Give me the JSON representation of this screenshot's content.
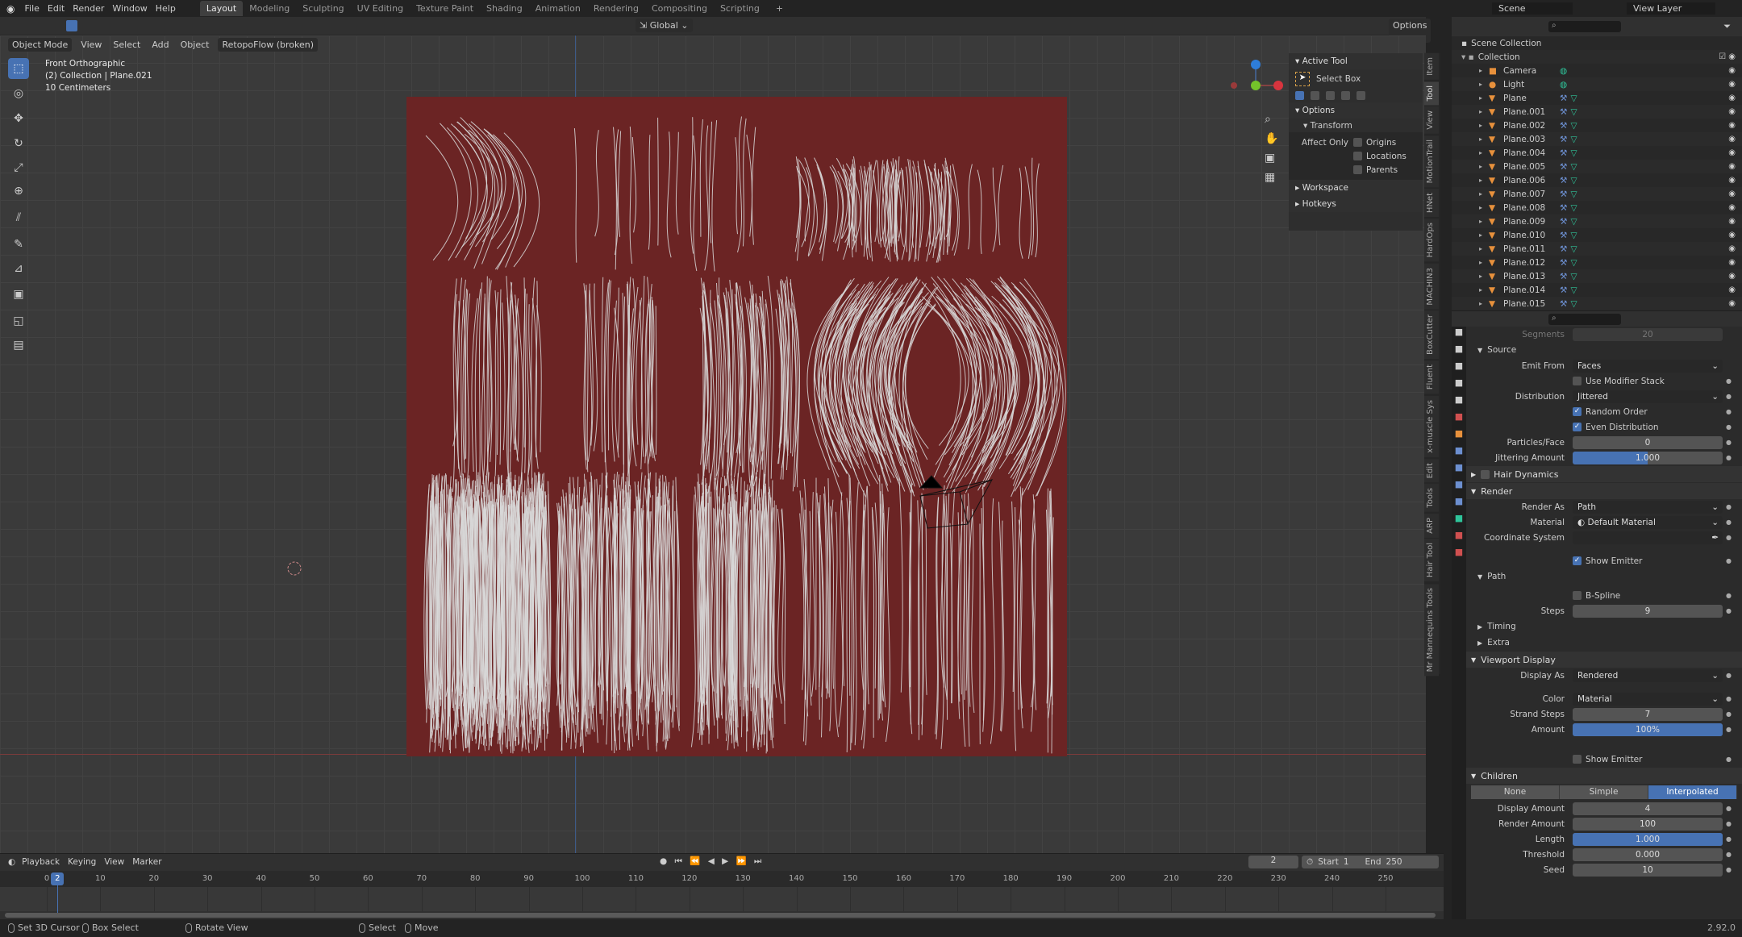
{
  "topbar": {
    "menus": [
      "File",
      "Edit",
      "Render",
      "Window",
      "Help"
    ],
    "workspaces": [
      "Layout",
      "Modeling",
      "Sculpting",
      "UV Editing",
      "Texture Paint",
      "Shading",
      "Animation",
      "Rendering",
      "Compositing",
      "Scripting"
    ],
    "active_workspace": "Layout",
    "scene": "Scene",
    "view_layer": "View Layer"
  },
  "tool_header": {
    "orientation": "Global",
    "options": "Options"
  },
  "viewport_header": {
    "mode": "Object Mode",
    "menus": [
      "View",
      "Select",
      "Add",
      "Object"
    ],
    "addon": "RetopoFlow (broken)"
  },
  "viewport_info": {
    "view": "Front Orthographic",
    "collection": "(2) Collection | Plane.021",
    "scale": "10 Centimeters"
  },
  "viewport": {
    "plane_color": "#6b2424",
    "hair_color": "#d8d8d8"
  },
  "toolbar": [
    "select-box",
    "cursor",
    "move",
    "rotate",
    "scale",
    "transform",
    "annotate-line",
    "annotate",
    "measure",
    "add-cube",
    "shear",
    "scale-cage"
  ],
  "npanel": {
    "active_tool_header": "Active Tool",
    "tool_name": "Select Box",
    "options_header": "Options",
    "transform_header": "Transform",
    "affect_only": "Affect Only",
    "affect_items": [
      "Origins",
      "Locations",
      "Parents"
    ],
    "workspace": "Workspace",
    "hotkeys": "Hotkeys",
    "tabs": [
      "Item",
      "Tool",
      "View",
      "MotionTrail",
      "HNet",
      "HardOps",
      "MACHIN3",
      "BoxCutter",
      "Fluent",
      "x-muscle Sys",
      "Edit",
      "Tools",
      "ARP",
      "Hair Tool",
      "Mr Mannequins Tools"
    ],
    "active_tab": "Tool"
  },
  "outliner": {
    "scene_collection": "Scene Collection",
    "collection": "Collection",
    "items": [
      "Camera",
      "Light",
      "Plane",
      "Plane.001",
      "Plane.002",
      "Plane.003",
      "Plane.004",
      "Plane.005",
      "Plane.006",
      "Plane.007",
      "Plane.008",
      "Plane.009",
      "Plane.010",
      "Plane.011",
      "Plane.012",
      "Plane.013",
      "Plane.014",
      "Plane.015"
    ]
  },
  "properties": {
    "rows": [
      {
        "kind": "field",
        "label": "Segments",
        "value": "20",
        "dim": true
      },
      {
        "kind": "sub",
        "label": "Source"
      },
      {
        "kind": "dd",
        "label": "Emit From",
        "value": "Faces"
      },
      {
        "kind": "check",
        "label": "Use Modifier Stack",
        "checked": false
      },
      {
        "kind": "dd",
        "label": "Distribution",
        "value": "Jittered"
      },
      {
        "kind": "check",
        "label": "Random Order",
        "checked": true
      },
      {
        "kind": "check",
        "label": "Even Distribution",
        "checked": true
      },
      {
        "kind": "field",
        "label": "Particles/Face",
        "value": "0"
      },
      {
        "kind": "bar",
        "label": "Jittering Amount",
        "value": "1.000",
        "fraction": 0.5
      },
      {
        "kind": "panel",
        "label": "Hair Dynamics",
        "open": false,
        "checkbox": true
      },
      {
        "kind": "panel",
        "label": "Render",
        "open": true
      },
      {
        "kind": "dd",
        "label": "Render As",
        "value": "Path"
      },
      {
        "kind": "dd",
        "label": "Material",
        "value": "Default Material"
      },
      {
        "kind": "dd",
        "label": "Coordinate System",
        "value": ""
      },
      {
        "kind": "check",
        "label": "Show Emitter",
        "checked": true
      },
      {
        "kind": "sub",
        "label": "Path"
      },
      {
        "kind": "check",
        "label": "B-Spline",
        "checked": false
      },
      {
        "kind": "field",
        "label": "Steps",
        "value": "9"
      },
      {
        "kind": "subc",
        "label": "Timing"
      },
      {
        "kind": "subc",
        "label": "Extra"
      },
      {
        "kind": "panel",
        "label": "Viewport Display",
        "open": true
      },
      {
        "kind": "dd",
        "label": "Display As",
        "value": "Rendered"
      },
      {
        "kind": "dd",
        "label": "Color",
        "value": "Material"
      },
      {
        "kind": "field",
        "label": "Strand Steps",
        "value": "7"
      },
      {
        "kind": "bar",
        "label": "Amount",
        "value": "100%",
        "fraction": 1.0
      },
      {
        "kind": "check",
        "label": "Show Emitter",
        "checked": false
      },
      {
        "kind": "panel",
        "label": "Children",
        "open": true
      },
      {
        "kind": "seg",
        "options": [
          "None",
          "Simple",
          "Interpolated"
        ],
        "selected": "Interpolated"
      },
      {
        "kind": "field",
        "label": "Display Amount",
        "value": "4"
      },
      {
        "kind": "field",
        "label": "Render Amount",
        "value": "100"
      },
      {
        "kind": "bar",
        "label": "Length",
        "value": "1.000",
        "fraction": 1.0
      },
      {
        "kind": "field",
        "label": "Threshold",
        "value": "0.000"
      },
      {
        "kind": "field",
        "label": "Seed",
        "value": "10"
      }
    ],
    "version": "2.92.0"
  },
  "timeline": {
    "menus": [
      "Playback",
      "Keying",
      "View",
      "Marker"
    ],
    "current_frame": 2,
    "start_label": "Start",
    "start": 1,
    "end_label": "End",
    "end": 250,
    "ticks": [
      0,
      10,
      20,
      30,
      40,
      50,
      60,
      70,
      80,
      90,
      100,
      110,
      120,
      130,
      140,
      150,
      160,
      170,
      180,
      190,
      200,
      210,
      220,
      230,
      240,
      250
    ]
  },
  "status": {
    "items": [
      "Set 3D Cursor",
      "Box Select",
      "Rotate View",
      "Select",
      "Move"
    ]
  },
  "colors": {
    "accent": "#4772b3"
  }
}
